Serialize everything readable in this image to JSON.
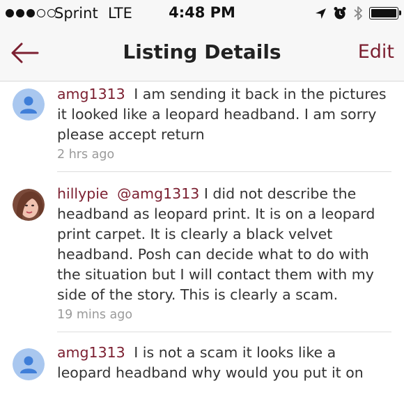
{
  "status_bar": {
    "carrier": "Sprint",
    "network": "LTE",
    "time": "4:48 PM",
    "signal_bars_filled": 3,
    "signal_bars_total": 5,
    "icons": [
      "location-arrow-icon",
      "alarm-icon",
      "bluetooth-icon",
      "battery-icon"
    ]
  },
  "nav": {
    "title": "Listing Details",
    "edit_label": "Edit",
    "back_icon": "back-arrow-icon",
    "accent_color": "#7b1f30"
  },
  "comments": [
    {
      "username": "amg1313",
      "mention": "",
      "text": "I am sending it back in the pictures it looked like a leopard headband. I am sorry please accept return",
      "time": "2 hrs ago",
      "avatar": "default-user-icon"
    },
    {
      "username": "hillypie",
      "mention": "@amg1313",
      "text": "I did not describe the headband as leopard print. It is on a leopard print carpet. It is clearly a black velvet headband. Posh can decide what to do with the situation but I will contact them with my side of the story. This is clearly a scam.",
      "time": "19 mins ago",
      "avatar": "profile-photo"
    },
    {
      "username": "amg1313",
      "mention": "",
      "text": "I is not a scam it looks like a leopard headband why would you put it on",
      "time": "",
      "avatar": "default-user-icon"
    }
  ]
}
